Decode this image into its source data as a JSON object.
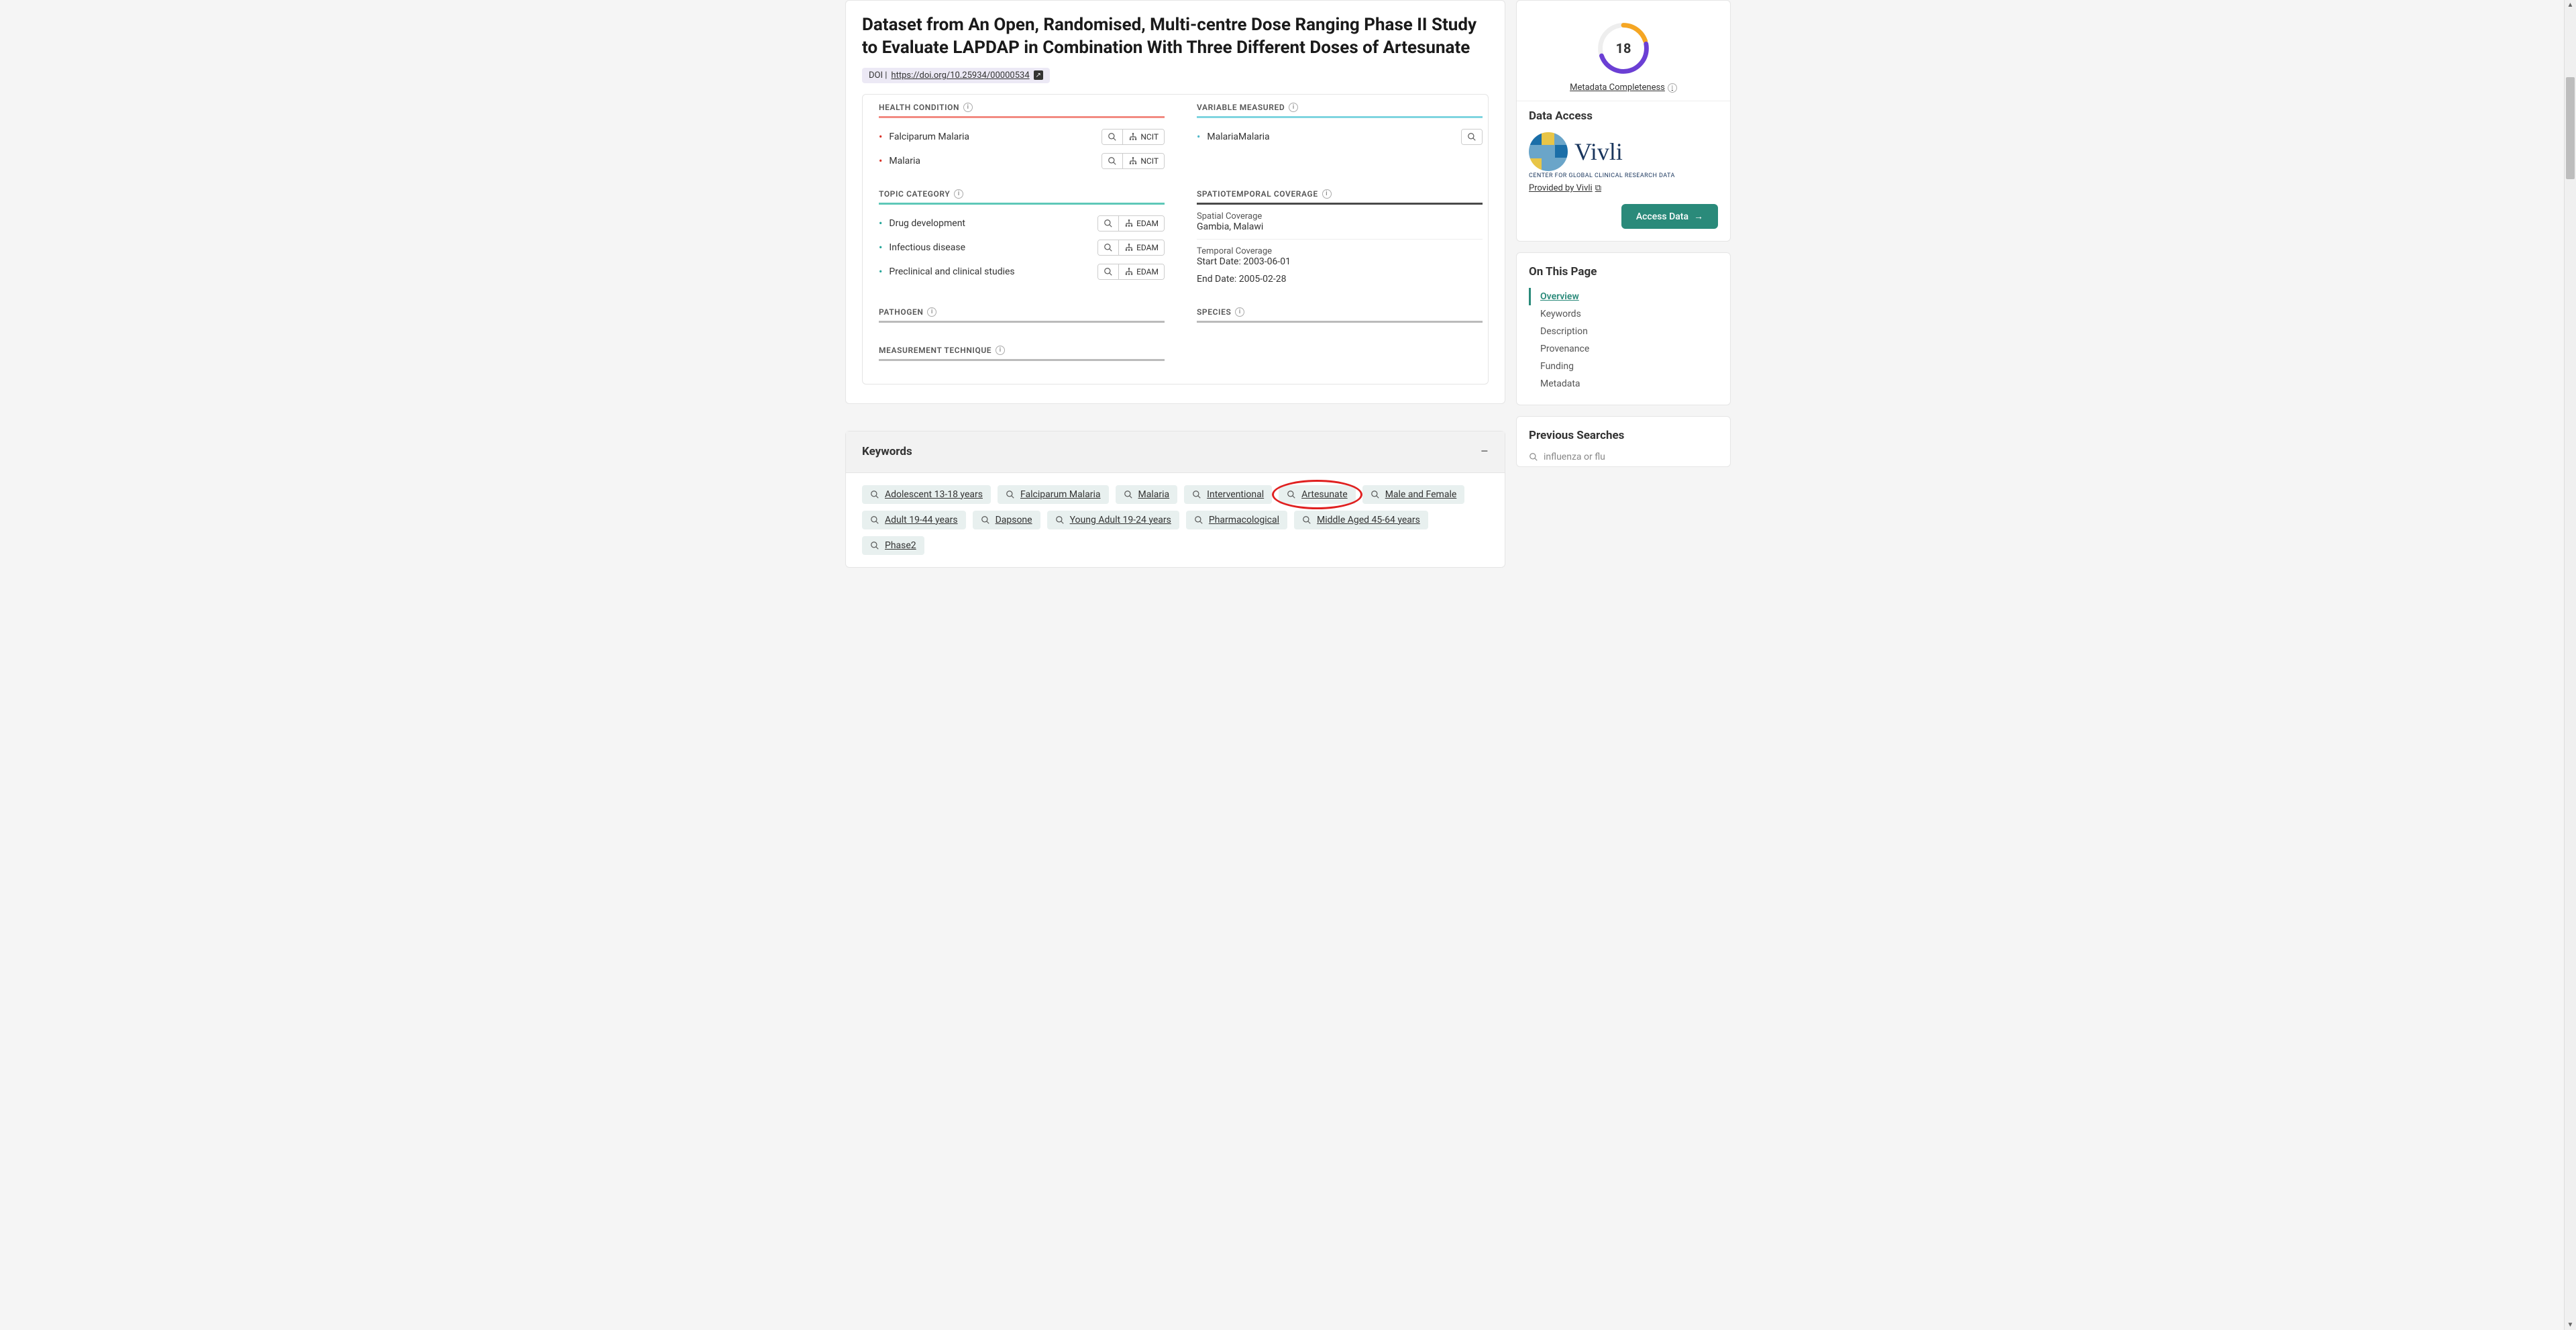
{
  "title": "Dataset from An Open, Randomised, Multi-centre Dose Ranging Phase II Study to Evaluate LAPDAP in Combination With Three Different Doses of Artesunate",
  "doi": {
    "prefix": "DOI |",
    "url": "https://doi.org/10.25934/00000534"
  },
  "sections": {
    "health_condition": {
      "heading": "HEALTH CONDITION",
      "items": [
        {
          "label": "Falciparum Malaria",
          "badge": "NCIT"
        },
        {
          "label": "Malaria",
          "badge": "NCIT"
        }
      ]
    },
    "variable_measured": {
      "heading": "VARIABLE MEASURED",
      "items": [
        {
          "label": "MalariaMalaria"
        }
      ]
    },
    "topic_category": {
      "heading": "TOPIC CATEGORY",
      "items": [
        {
          "label": "Drug development",
          "badge": "EDAM"
        },
        {
          "label": "Infectious disease",
          "badge": "EDAM"
        },
        {
          "label": "Preclinical and clinical studies",
          "badge": "EDAM"
        }
      ]
    },
    "spatiotemporal": {
      "heading": "SPATIOTEMPORAL COVERAGE",
      "spatial_label": "Spatial Coverage",
      "spatial_value": "Gambia, Malawi",
      "temporal_label": "Temporal Coverage",
      "start_label": "Start Date:",
      "start_value": "2003-06-01",
      "end_label": "End Date:",
      "end_value": "2005-02-28"
    },
    "pathogen": {
      "heading": "PATHOGEN"
    },
    "species": {
      "heading": "SPECIES"
    },
    "measurement": {
      "heading": "MEASUREMENT TECHNIQUE"
    }
  },
  "keywords_section": {
    "heading": "Keywords",
    "keywords": [
      "Adolescent 13-18 years",
      "Falciparum Malaria",
      "Malaria",
      "Interventional",
      "Artesunate",
      "Male and Female",
      "Adult 19-44 years",
      "Dapsone",
      "Young Adult 19-24 years",
      "Pharmacological",
      "Middle Aged 45-64 years",
      "Phase2"
    ],
    "circled_index": 4
  },
  "sidebar": {
    "score": "18",
    "metadata_completeness": "Metadata Completeness",
    "data_access_heading": "Data Access",
    "vivli_name": "Vivli",
    "vivli_sub": "CENTER FOR GLOBAL CLINICAL RESEARCH DATA",
    "provided_by": "Provided by Vivli",
    "access_btn": "Access Data",
    "on_this_page": "On This Page",
    "toc": [
      {
        "label": "Overview",
        "active": true
      },
      {
        "label": "Keywords",
        "active": false
      },
      {
        "label": "Description",
        "active": false
      },
      {
        "label": "Provenance",
        "active": false
      },
      {
        "label": "Funding",
        "active": false
      },
      {
        "label": "Metadata",
        "active": false
      }
    ],
    "prev_searches_heading": "Previous Searches",
    "prev_search_item": "influenza or flu"
  }
}
